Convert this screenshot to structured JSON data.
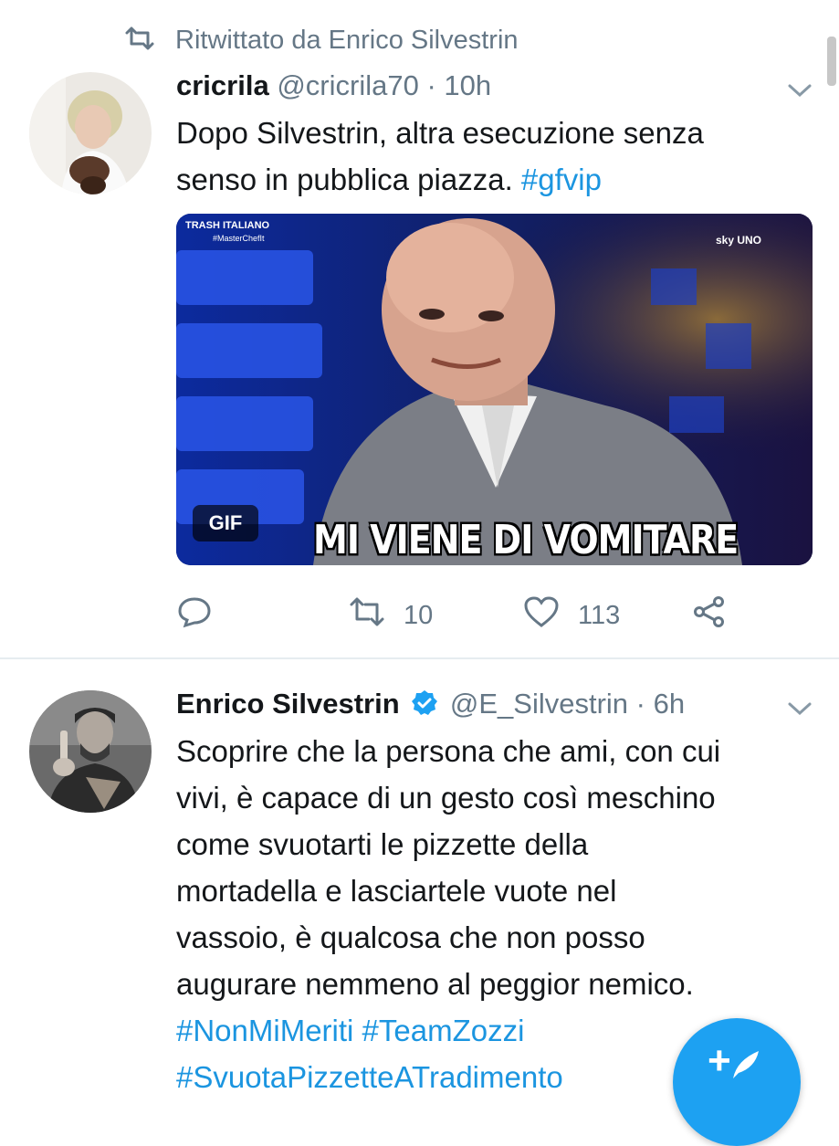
{
  "retweet_header": {
    "icon": "retweet-icon",
    "text": "Ritwittato da Enrico Silvestrin"
  },
  "tweet1": {
    "display_name": "cricrila",
    "handle": "@cricrila70",
    "separator": "·",
    "time": "10h",
    "text_lines": [
      "Dopo Silvestrin, altra esecuzione senza",
      "senso in pubblica piazza. "
    ],
    "hashtag": "#gfvip",
    "media": {
      "badge": "GIF",
      "caption": "MI VIENE DI VOMITARE",
      "logo_top_left": "TRASH ITALIANO",
      "logo_top_left_sub": "#MasterChefIt",
      "logo_top_right": "sky UNO"
    },
    "actions": {
      "reply_icon": "reply-icon",
      "retweets": "10",
      "likes": "113",
      "share_icon": "share-icon"
    }
  },
  "tweet2": {
    "display_name": "Enrico Silvestrin",
    "verified_icon": "verified-badge-icon",
    "handle": "@E_Silvestrin",
    "separator": "·",
    "time": "6h",
    "text_lines": [
      "Scoprire che la persona che ami, con cui",
      "vivi, è capace di un gesto così meschino",
      "come svuotarti le pizzette della",
      "mortadella e lasciartele vuote nel",
      "vassoio, è qualcosa che non posso",
      "augurare nemmeno al peggior nemico."
    ],
    "hashtags_line1": "#NonMiMeriti #TeamZozzi",
    "hashtags_line2": "#SvuotaPizzetteATradimento"
  },
  "compose_button": {
    "label": "+"
  },
  "colors": {
    "link": "#1b95e0",
    "muted": "#657786",
    "accent": "#1da1f2",
    "text": "#14171a"
  }
}
